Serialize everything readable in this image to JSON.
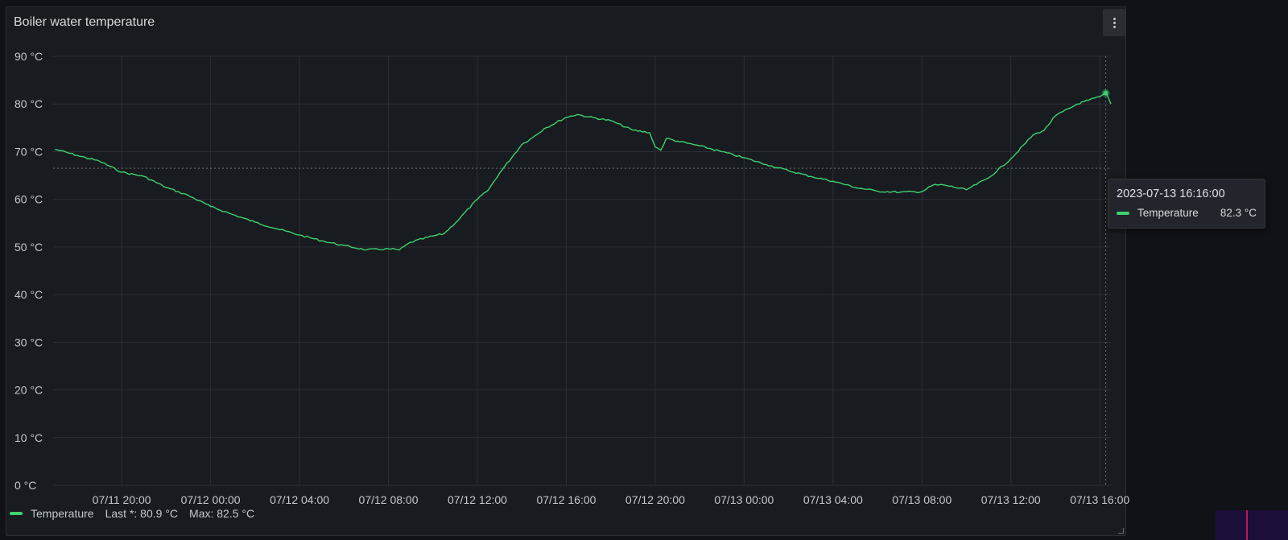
{
  "panel": {
    "title": "Boiler water temperature",
    "menu_icon": "kebab-vertical-icon"
  },
  "legend": {
    "series_name": "Temperature",
    "last_label": "Last *: 80.9 °C",
    "max_label": "Max: 82.5 °C",
    "color": "#3ed170"
  },
  "tooltip": {
    "time": "2023-07-13 16:16:00",
    "series_name": "Temperature",
    "value": "82.3 °C"
  },
  "chart_data": {
    "type": "line",
    "title": "Boiler water temperature",
    "xlabel": "",
    "ylabel": "",
    "unit": "°C",
    "ylim": [
      0,
      90
    ],
    "y_ticks": [
      "0 °C",
      "10 °C",
      "20 °C",
      "30 °C",
      "40 °C",
      "50 °C",
      "60 °C",
      "70 °C",
      "80 °C",
      "90 °C"
    ],
    "x_ticks": [
      {
        "label": "07/11 20:00",
        "t": "2023-07-11 20:00"
      },
      {
        "label": "07/12 00:00",
        "t": "2023-07-12 00:00"
      },
      {
        "label": "07/12 04:00",
        "t": "2023-07-12 04:00"
      },
      {
        "label": "07/12 08:00",
        "t": "2023-07-12 08:00"
      },
      {
        "label": "07/12 12:00",
        "t": "2023-07-12 12:00"
      },
      {
        "label": "07/12 16:00",
        "t": "2023-07-12 16:00"
      },
      {
        "label": "07/12 20:00",
        "t": "2023-07-12 20:00"
      },
      {
        "label": "07/13 00:00",
        "t": "2023-07-13 00:00"
      },
      {
        "label": "07/13 04:00",
        "t": "2023-07-13 04:00"
      },
      {
        "label": "07/13 08:00",
        "t": "2023-07-13 08:00"
      },
      {
        "label": "07/13 12:00",
        "t": "2023-07-13 12:00"
      },
      {
        "label": "07/13 16:00",
        "t": "2023-07-13 16:00"
      }
    ],
    "xlim": [
      "2023-07-11 16:55",
      "2023-07-13 16:30"
    ],
    "grid": true,
    "legend_position": "bottom-left",
    "series": [
      {
        "name": "Temperature",
        "color": "#3ed170",
        "points": [
          [
            "2023-07-11 17:00",
            70.5
          ],
          [
            "2023-07-11 18:00",
            69.2
          ],
          [
            "2023-07-11 19:00",
            68.0
          ],
          [
            "2023-07-11 20:00",
            65.7
          ],
          [
            "2023-07-11 21:00",
            64.8
          ],
          [
            "2023-07-11 22:00",
            62.5
          ],
          [
            "2023-07-11 23:00",
            60.8
          ],
          [
            "2023-07-12 00:00",
            58.5
          ],
          [
            "2023-07-12 01:00",
            56.8
          ],
          [
            "2023-07-12 02:00",
            55.2
          ],
          [
            "2023-07-12 03:00",
            53.8
          ],
          [
            "2023-07-12 04:00",
            52.5
          ],
          [
            "2023-07-12 05:00",
            51.3
          ],
          [
            "2023-07-12 06:00",
            50.3
          ],
          [
            "2023-07-12 07:00",
            49.4
          ],
          [
            "2023-07-12 08:00",
            49.6
          ],
          [
            "2023-07-12 08:30",
            49.4
          ],
          [
            "2023-07-12 09:00",
            51.0
          ],
          [
            "2023-07-12 10:00",
            52.3
          ],
          [
            "2023-07-12 10:30",
            52.8
          ],
          [
            "2023-07-12 11:00",
            55.0
          ],
          [
            "2023-07-12 12:00",
            60.0
          ],
          [
            "2023-07-12 12:30",
            62.0
          ],
          [
            "2023-07-12 13:00",
            65.5
          ],
          [
            "2023-07-12 14:00",
            71.5
          ],
          [
            "2023-07-12 14:30",
            73.0
          ],
          [
            "2023-07-12 15:00",
            74.8
          ],
          [
            "2023-07-12 16:00",
            77.2
          ],
          [
            "2023-07-12 16:30",
            77.8
          ],
          [
            "2023-07-12 17:00",
            77.3
          ],
          [
            "2023-07-12 18:00",
            76.5
          ],
          [
            "2023-07-12 19:00",
            74.5
          ],
          [
            "2023-07-12 19:45",
            74.0
          ],
          [
            "2023-07-12 20:00",
            71.0
          ],
          [
            "2023-07-12 20:15",
            70.3
          ],
          [
            "2023-07-12 20:30",
            72.8
          ],
          [
            "2023-07-12 21:00",
            72.2
          ],
          [
            "2023-07-12 22:00",
            71.2
          ],
          [
            "2023-07-12 23:00",
            70.0
          ],
          [
            "2023-07-13 00:00",
            68.7
          ],
          [
            "2023-07-13 01:00",
            67.3
          ],
          [
            "2023-07-13 02:00",
            66.0
          ],
          [
            "2023-07-13 03:00",
            64.8
          ],
          [
            "2023-07-13 04:00",
            63.8
          ],
          [
            "2023-07-13 05:00",
            62.5
          ],
          [
            "2023-07-13 06:00",
            61.7
          ],
          [
            "2023-07-13 07:00",
            61.5
          ],
          [
            "2023-07-13 08:00",
            61.6
          ],
          [
            "2023-07-13 08:30",
            63.0
          ],
          [
            "2023-07-13 09:00",
            63.0
          ],
          [
            "2023-07-13 10:00",
            62.0
          ],
          [
            "2023-07-13 11:00",
            64.5
          ],
          [
            "2023-07-13 12:00",
            68.5
          ],
          [
            "2023-07-13 13:00",
            73.5
          ],
          [
            "2023-07-13 13:30",
            74.5
          ],
          [
            "2023-07-13 14:00",
            77.5
          ],
          [
            "2023-07-13 15:00",
            80.0
          ],
          [
            "2023-07-13 15:30",
            80.8
          ],
          [
            "2023-07-13 16:00",
            81.5
          ],
          [
            "2023-07-13 16:16",
            82.3
          ],
          [
            "2023-07-13 16:20",
            81.8
          ],
          [
            "2023-07-13 16:30",
            80.0
          ]
        ]
      }
    ],
    "hover": {
      "t": "2023-07-13 16:16",
      "value": 82.3,
      "crosshair_y_value": 66.5
    }
  }
}
